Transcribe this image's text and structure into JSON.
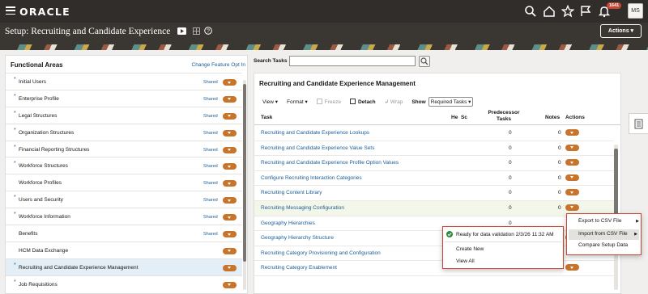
{
  "topbar": {
    "brand": "ORACLE",
    "notification_count": "1641",
    "user_initials": "MS",
    "icons": [
      "hamburger-icon",
      "search-icon",
      "home-icon",
      "star-icon",
      "flag-icon",
      "bell-icon"
    ]
  },
  "page": {
    "title": "Setup: Recruiting and Candidate Experience",
    "actions_label": "Actions"
  },
  "functional_areas": {
    "heading": "Functional Areas",
    "change_link": "Change Feature Opt In",
    "items": [
      {
        "label": "Initial Users",
        "star": "*",
        "shared": "Shared",
        "selected": false
      },
      {
        "label": "Enterprise Profile",
        "star": "*",
        "shared": "Shared",
        "selected": false
      },
      {
        "label": "Legal Structures",
        "star": "*",
        "shared": "Shared",
        "selected": false
      },
      {
        "label": "Organization Structures",
        "star": "*",
        "shared": "Shared",
        "selected": false
      },
      {
        "label": "Financial Reporting Structures",
        "star": "*",
        "shared": "Shared",
        "selected": false
      },
      {
        "label": "Workforce Structures",
        "star": "*",
        "shared": "Shared",
        "selected": false
      },
      {
        "label": "Workforce Profiles",
        "star": "",
        "shared": "Shared",
        "selected": false
      },
      {
        "label": "Users and Security",
        "star": "*",
        "shared": "Shared",
        "selected": false
      },
      {
        "label": "Workforce Information",
        "star": "*",
        "shared": "Shared",
        "selected": false
      },
      {
        "label": "Benefits",
        "star": "",
        "shared": "Shared",
        "selected": false
      },
      {
        "label": "HCM Data Exchange",
        "star": "",
        "shared": "",
        "selected": false
      },
      {
        "label": "Recruiting and Candidate Experience Management",
        "star": "*",
        "shared": "",
        "selected": true
      },
      {
        "label": "Job Requisitions",
        "star": "*",
        "shared": "",
        "selected": false
      }
    ]
  },
  "search": {
    "label": "Search Tasks",
    "value": ""
  },
  "task_panel": {
    "heading": "Recruiting and Candidate Experience Management",
    "toolbar": {
      "view": "View",
      "format": "Format",
      "freeze": "Freeze",
      "detach": "Detach",
      "wrap": "Wrap",
      "show_label": "Show",
      "show_value": "Required Tasks"
    },
    "columns": {
      "task": "Task",
      "he": "He",
      "sc": "Sc",
      "predecessor": "Predecessor",
      "tasks": "Tasks",
      "notes": "Notes",
      "actions": "Actions"
    },
    "rows": [
      {
        "task": "Recruiting and Candidate Experience Lookups",
        "predecessor": "0",
        "notes": "0"
      },
      {
        "task": "Recruiting and Candidate Experience Value Sets",
        "predecessor": "0",
        "notes": "0"
      },
      {
        "task": "Recruiting and Candidate Experience Profile Option Values",
        "predecessor": "0",
        "notes": "0"
      },
      {
        "task": "Configure Recruiting Interaction Categories",
        "predecessor": "0",
        "notes": "0"
      },
      {
        "task": "Recruiting Content Library",
        "predecessor": "0",
        "notes": "0"
      },
      {
        "task": "Recruiting Messaging Configuration",
        "predecessor": "0",
        "notes": "0"
      },
      {
        "task": "Geography Hierarchies",
        "predecessor": "0",
        "notes": ""
      },
      {
        "task": "Geography Hierarchy Structure",
        "predecessor": "",
        "notes": ""
      },
      {
        "task": "Recruiting Category Provisioning and Configuration",
        "predecessor": "",
        "notes": ""
      },
      {
        "task": "Recruiting Category Enablement",
        "predecessor": "",
        "notes": ""
      }
    ]
  },
  "context_menu": {
    "status": "Ready for data validation 2/3/26 11:32 AM",
    "items": [
      "Create New",
      "View All"
    ]
  },
  "actions_menu": {
    "items": [
      "Export to CSV File",
      "Import from CSV File",
      "Compare Setup Data"
    ]
  },
  "colors": {
    "topbar": "#312d2a",
    "accent_chevron": "#c8742a",
    "link": "#1b5c95",
    "highlight_border": "#c74634",
    "status_ok": "#2e8b3a"
  }
}
